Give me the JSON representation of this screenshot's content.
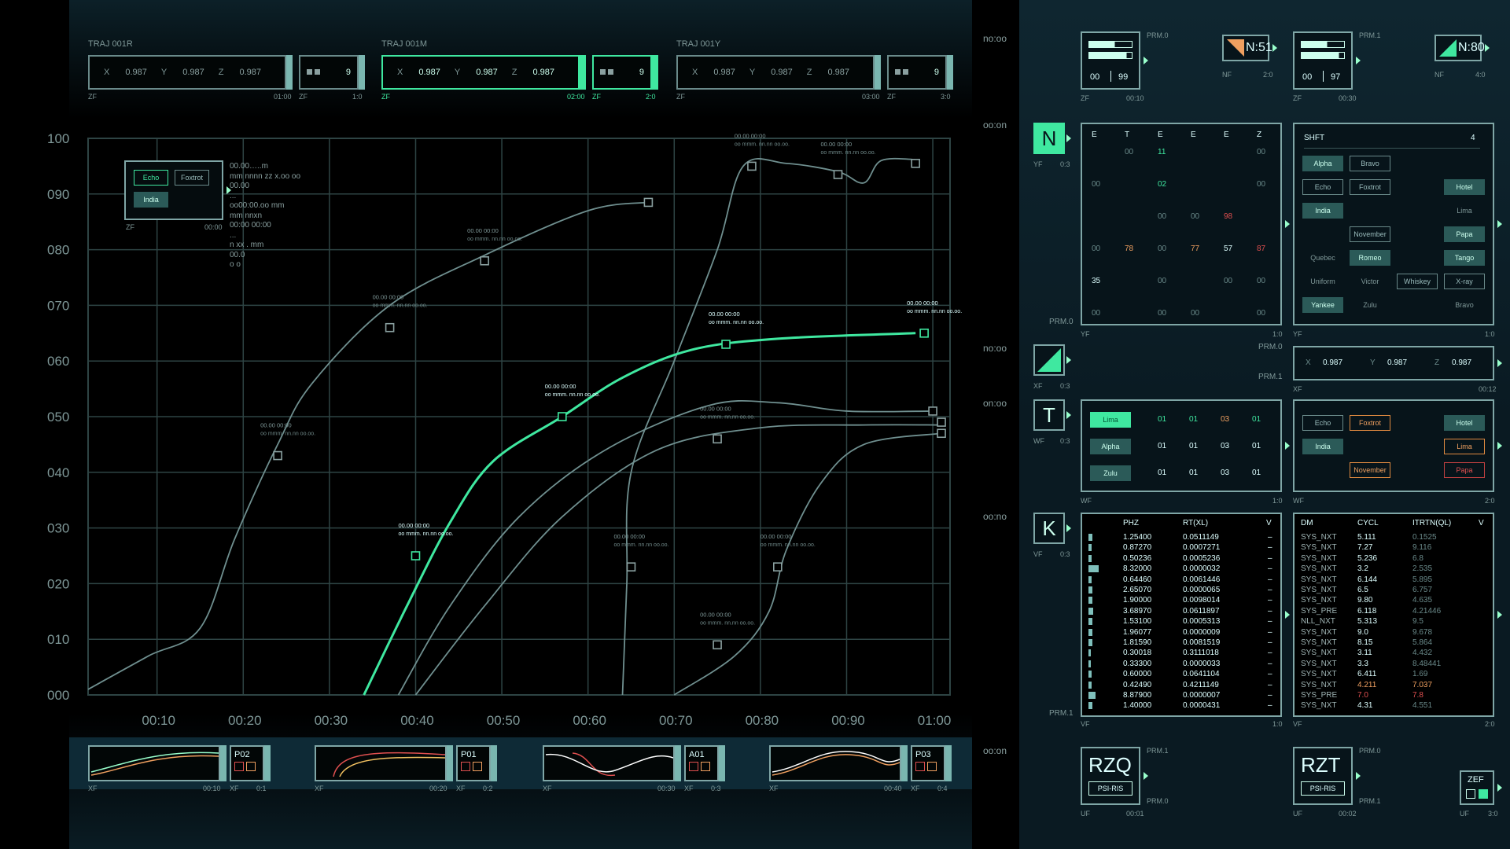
{
  "trajectories": [
    {
      "title": "TRAJ 001R",
      "x": "0.987",
      "y": "0.987",
      "z": "0.987",
      "count": "9",
      "left_foot": "ZF",
      "time": "01:00",
      "mini_foot": "ZF",
      "ratio": "1:0",
      "active": false
    },
    {
      "title": "TRAJ 001M",
      "x": "0.987",
      "y": "0.987",
      "z": "0.987",
      "count": "9",
      "left_foot": "ZF",
      "time": "02:00",
      "mini_foot": "ZF",
      "ratio": "2:0",
      "active": true
    },
    {
      "title": "TRAJ 001Y",
      "x": "0.987",
      "y": "0.987",
      "z": "0.987",
      "count": "9",
      "left_foot": "ZF",
      "time": "03:00",
      "mini_foot": "ZF",
      "ratio": "3:0",
      "active": false
    }
  ],
  "axis_letters": {
    "x": "X",
    "y": "Y",
    "z": "Z"
  },
  "legend": {
    "buttons": [
      "Echo",
      "Foxtrot",
      "India"
    ],
    "foot_left": "ZF",
    "foot_right": "00:00",
    "text_lines": [
      "00.00…..m",
      "mm nnnn zz x.oo oo",
      "00.00",
      "...",
      "oo00:00.oo mm",
      "mm nnxn",
      "00:00 00:00",
      "...",
      "n xx . mm",
      "00.0",
      "o o"
    ]
  },
  "chart_data": {
    "type": "line",
    "x_ticks": [
      "00:10",
      "00:20",
      "00:30",
      "00:40",
      "00:50",
      "00:60",
      "00:70",
      "00:80",
      "00:90",
      "01:00"
    ],
    "y_ticks": [
      "000",
      "010",
      "020",
      "030",
      "040",
      "050",
      "060",
      "070",
      "080",
      "090",
      "100"
    ],
    "ylim": [
      0,
      100
    ],
    "xlim": [
      0,
      100
    ],
    "grid": true,
    "series": [
      {
        "highlight": false,
        "points": [
          [
            0,
            1
          ],
          [
            7,
            7
          ],
          [
            13,
            12
          ],
          [
            17,
            28
          ],
          [
            22,
            45
          ],
          [
            26,
            56
          ],
          [
            35,
            70
          ],
          [
            46,
            79
          ],
          [
            58,
            87
          ],
          [
            65,
            88.5
          ]
        ]
      },
      {
        "highlight": false,
        "points": [
          [
            62,
            0
          ],
          [
            62.5,
            20
          ],
          [
            63,
            40
          ],
          [
            68,
            60
          ],
          [
            73,
            80
          ],
          [
            76,
            95
          ],
          [
            81,
            95.5
          ],
          [
            87,
            94
          ],
          [
            90,
            92
          ],
          [
            92,
            96
          ],
          [
            96,
            96.2
          ]
        ]
      },
      {
        "highlight": true,
        "points": [
          [
            32,
            0
          ],
          [
            37,
            16
          ],
          [
            42,
            31
          ],
          [
            47,
            42
          ],
          [
            55,
            50
          ],
          [
            62,
            57
          ],
          [
            70,
            62
          ],
          [
            80,
            64
          ],
          [
            96,
            65
          ]
        ]
      },
      {
        "highlight": false,
        "points": [
          [
            36,
            0
          ],
          [
            42,
            16
          ],
          [
            50,
            32
          ],
          [
            60,
            44
          ],
          [
            72,
            52
          ],
          [
            80,
            52.5
          ],
          [
            88,
            51
          ],
          [
            98,
            51
          ]
        ]
      },
      {
        "highlight": false,
        "points": [
          [
            38,
            0
          ],
          [
            46,
            16
          ],
          [
            55,
            32
          ],
          [
            66,
            44
          ],
          [
            78,
            48
          ],
          [
            90,
            48.5
          ],
          [
            99,
            48.5
          ]
        ]
      },
      {
        "highlight": false,
        "points": [
          [
            68,
            0
          ],
          [
            75,
            7
          ],
          [
            79,
            15
          ],
          [
            81,
            26
          ],
          [
            85,
            38
          ],
          [
            90,
            45
          ],
          [
            99,
            47
          ]
        ]
      }
    ],
    "markers": [
      {
        "x": 22,
        "y": 43,
        "label": "00.00 00:00",
        "highlight": false
      },
      {
        "x": 35,
        "y": 66,
        "label": "00.00 00:00",
        "highlight": false
      },
      {
        "x": 46,
        "y": 78,
        "label": "00.00 00:00",
        "highlight": false
      },
      {
        "x": 65,
        "y": 88.5,
        "label": "",
        "highlight": false
      },
      {
        "x": 38,
        "y": 25,
        "label": "00.00 00:00",
        "highlight": true
      },
      {
        "x": 55,
        "y": 50,
        "label": "00.00 00:00",
        "highlight": true
      },
      {
        "x": 74,
        "y": 63,
        "label": "00.00 00:00",
        "highlight": true
      },
      {
        "x": 97,
        "y": 65,
        "label": "00.00 00:00",
        "highlight": true
      },
      {
        "x": 63,
        "y": 23,
        "label": "00.00 00:00",
        "highlight": false
      },
      {
        "x": 73,
        "y": 46,
        "label": "00.00 00:00",
        "highlight": false
      },
      {
        "x": 77,
        "y": 95,
        "label": "00.00 00:00",
        "highlight": false
      },
      {
        "x": 87,
        "y": 93.5,
        "label": "00.00 00:00",
        "highlight": false
      },
      {
        "x": 96,
        "y": 95.5,
        "label": "",
        "highlight": false
      },
      {
        "x": 98,
        "y": 51,
        "label": "",
        "highlight": false
      },
      {
        "x": 99,
        "y": 49,
        "label": "",
        "highlight": false
      },
      {
        "x": 99,
        "y": 47,
        "label": "",
        "highlight": false
      },
      {
        "x": 80,
        "y": 23,
        "label": "00.00 00:00",
        "highlight": false
      },
      {
        "x": 73,
        "y": 9,
        "label": "00.00 00:00",
        "highlight": false
      }
    ],
    "marker_sublabel": "oo mmm. nn.nn oo.oo."
  },
  "strips": [
    {
      "code": "P02",
      "foot": "XF",
      "time": "00:10",
      "ratio": "0:1"
    },
    {
      "code": "P01",
      "foot": "XF",
      "time": "00:20",
      "ratio": "0:2"
    },
    {
      "code": "A01",
      "foot": "XF",
      "time": "00:30",
      "ratio": "0:3"
    },
    {
      "code": "P03",
      "foot": "XF",
      "time": "00:40",
      "ratio": "0:4"
    }
  ],
  "divider_labels": [
    "no:oo",
    "oo:on",
    "no:oo",
    "on:oo",
    "oo:no",
    "oo:on"
  ],
  "right": {
    "top_left": {
      "prm": "PRM.0",
      "left": "00",
      "right": "99",
      "foot": "ZF",
      "time": "00:10"
    },
    "n51": {
      "label": "N:51",
      "foot": "NF",
      "ratio": "2:0"
    },
    "top_right": {
      "prm": "PRM.1",
      "left": "00",
      "right": "97",
      "foot": "ZF",
      "time": "00:30"
    },
    "n80": {
      "label": "N:80",
      "foot": "NF",
      "ratio": "4:0"
    },
    "n_icon": {
      "letter": "N",
      "foot": "YF",
      "ratio": "0:3"
    },
    "grid_headers": [
      "E",
      "T",
      "E",
      "E",
      "E",
      "Z"
    ],
    "grid_foot": "YF",
    "grid_ratio": "1:0",
    "grid_prm": "PRM.0",
    "grid_cells": [
      {
        "c": 1,
        "r": 0,
        "v": "00",
        "k": ""
      },
      {
        "c": 2,
        "r": 0,
        "v": "11",
        "k": "g"
      },
      {
        "c": 5,
        "r": 0,
        "v": "00",
        "k": ""
      },
      {
        "c": 0,
        "r": 1,
        "v": "00",
        "k": ""
      },
      {
        "c": 2,
        "r": 1,
        "v": "02",
        "k": "g"
      },
      {
        "c": 5,
        "r": 1,
        "v": "00",
        "k": ""
      },
      {
        "c": 2,
        "r": 2,
        "v": "00",
        "k": ""
      },
      {
        "c": 3,
        "r": 2,
        "v": "00",
        "k": ""
      },
      {
        "c": 4,
        "r": 2,
        "v": "98",
        "k": "r"
      },
      {
        "c": 0,
        "r": 3,
        "v": "00",
        "k": ""
      },
      {
        "c": 1,
        "r": 3,
        "v": "78",
        "k": "o"
      },
      {
        "c": 2,
        "r": 3,
        "v": "00",
        "k": ""
      },
      {
        "c": 3,
        "r": 3,
        "v": "77",
        "k": "o"
      },
      {
        "c": 4,
        "r": 3,
        "v": "57",
        "k": "w"
      },
      {
        "c": 5,
        "r": 3,
        "v": "87",
        "k": "r"
      },
      {
        "c": 0,
        "r": 4,
        "v": "35",
        "k": "w"
      },
      {
        "c": 2,
        "r": 4,
        "v": "00",
        "k": ""
      },
      {
        "c": 4,
        "r": 4,
        "v": "00",
        "k": ""
      },
      {
        "c": 5,
        "r": 4,
        "v": "00",
        "k": ""
      },
      {
        "c": 0,
        "r": 5,
        "v": "00",
        "k": ""
      },
      {
        "c": 2,
        "r": 5,
        "v": "00",
        "k": ""
      },
      {
        "c": 3,
        "r": 5,
        "v": "00",
        "k": ""
      },
      {
        "c": 5,
        "r": 5,
        "v": "00",
        "k": ""
      }
    ],
    "shft": {
      "title": "SHFT",
      "count": "4",
      "foot": "YF",
      "ratio": "1:0",
      "buttons": [
        {
          "t": "Alpha",
          "s": "f",
          "c": 0,
          "r": 0
        },
        {
          "t": "Bravo",
          "s": "o",
          "c": 1,
          "r": 0
        },
        {
          "t": "Echo",
          "s": "o",
          "c": 0,
          "r": 1
        },
        {
          "t": "Foxtrot",
          "s": "o",
          "c": 1,
          "r": 1
        },
        {
          "t": "Hotel",
          "s": "f",
          "c": 3,
          "r": 1
        },
        {
          "t": "India",
          "s": "f",
          "c": 0,
          "r": 2
        },
        {
          "t": "Lima",
          "s": "t",
          "c": 3,
          "r": 2
        },
        {
          "t": "November",
          "s": "o",
          "c": 1,
          "r": 3
        },
        {
          "t": "Papa",
          "s": "f",
          "c": 3,
          "r": 3
        },
        {
          "t": "Quebec",
          "s": "t",
          "c": 0,
          "r": 4
        },
        {
          "t": "Romeo",
          "s": "f",
          "c": 1,
          "r": 4
        },
        {
          "t": "Tango",
          "s": "f",
          "c": 3,
          "r": 4
        },
        {
          "t": "Uniform",
          "s": "t",
          "c": 0,
          "r": 5
        },
        {
          "t": "Victor",
          "s": "t",
          "c": 1,
          "r": 5
        },
        {
          "t": "Whiskey",
          "s": "o",
          "c": 2,
          "r": 5
        },
        {
          "t": "X-ray",
          "s": "o",
          "c": 3,
          "r": 5
        },
        {
          "t": "Yankee",
          "s": "f",
          "c": 0,
          "r": 6
        },
        {
          "t": "Zulu",
          "s": "t",
          "c": 1,
          "r": 6
        },
        {
          "t": "Bravo",
          "s": "t",
          "c": 3,
          "r": 6
        }
      ]
    },
    "prm_mid_0": "PRM.0",
    "prm_mid_1": "PRM.1",
    "tri_icon": {
      "foot": "XF",
      "ratio": "0:3"
    },
    "xyz": {
      "x": "0.987",
      "y": "0.987",
      "z": "0.987",
      "foot": "XF",
      "time": "00:12"
    },
    "t_icon": {
      "letter": "T",
      "foot": "WF",
      "ratio": "0:3"
    },
    "t_rows": [
      {
        "name": "Lima",
        "active": true,
        "vals": [
          [
            "01",
            "g"
          ],
          [
            "01",
            "g"
          ],
          [
            "03",
            "o"
          ],
          [
            "01",
            "g"
          ]
        ]
      },
      {
        "name": "Alpha",
        "active": false,
        "vals": [
          [
            "01",
            "w"
          ],
          [
            "01",
            "w"
          ],
          [
            "03",
            "w"
          ],
          [
            "01",
            "w"
          ]
        ]
      },
      {
        "name": "Zulu",
        "active": false,
        "vals": [
          [
            "01",
            "w"
          ],
          [
            "01",
            "w"
          ],
          [
            "03",
            "w"
          ],
          [
            "01",
            "w"
          ]
        ]
      }
    ],
    "t_foot": "WF",
    "t_ratio": "1:0",
    "tr_buttons": [
      {
        "t": "Echo",
        "s": "o",
        "c": 0,
        "r": 0
      },
      {
        "t": "Foxtrot",
        "s": "orange",
        "c": 1,
        "r": 0
      },
      {
        "t": "Hotel",
        "s": "f",
        "c": 3,
        "r": 0
      },
      {
        "t": "India",
        "s": "f",
        "c": 0,
        "r": 1
      },
      {
        "t": "Lima",
        "s": "orange",
        "c": 3,
        "r": 1
      },
      {
        "t": "November",
        "s": "orange",
        "c": 1,
        "r": 2
      },
      {
        "t": "Papa",
        "s": "red",
        "c": 3,
        "r": 2
      }
    ],
    "tr_foot": "WF",
    "tr_ratio": "2:0",
    "k_icon": {
      "letter": "K",
      "foot": "VF",
      "ratio": "0:3"
    },
    "phz_headers": [
      "PHZ",
      "RT(XL)",
      "V"
    ],
    "phz_rows": [
      {
        "a": "1.25400",
        "b": "0.0511149",
        "v": "–",
        "bar": 0.3
      },
      {
        "a": "0.87270",
        "b": "0.0007271",
        "v": "–",
        "bar": 0.2
      },
      {
        "a": "0.50236",
        "b": "0.0005236",
        "v": "–",
        "bar": 0.2
      },
      {
        "a": "8.32000",
        "b": "0.0000032",
        "v": "–",
        "bar": 0.7
      },
      {
        "a": "0.64460",
        "b": "0.0061446",
        "v": "–",
        "bar": 0.2
      },
      {
        "a": "2.65070",
        "b": "0.0000065",
        "v": "–",
        "bar": 0.3
      },
      {
        "a": "1.90000",
        "b": "0.0098014",
        "v": "–",
        "bar": 0.25
      },
      {
        "a": "3.68970",
        "b": "0.0611897",
        "v": "–",
        "bar": 0.35
      },
      {
        "a": "1.53100",
        "b": "0.0005313",
        "v": "–",
        "bar": 0.25
      },
      {
        "a": "1.96077",
        "b": "0.0000009",
        "v": "–",
        "bar": 0.25
      },
      {
        "a": "1.81590",
        "b": "0.0081519",
        "v": "–",
        "bar": 0.25
      },
      {
        "a": "0.30018",
        "b": "0.3111018",
        "v": "–",
        "bar": 0.15
      },
      {
        "a": "0.33300",
        "b": "0.0000033",
        "v": "–",
        "bar": 0.15
      },
      {
        "a": "0.60000",
        "b": "0.0641104",
        "v": "–",
        "bar": 0.2
      },
      {
        "a": "0.42490",
        "b": "0.4211149",
        "v": "–",
        "bar": 0.2
      },
      {
        "a": "8.87900",
        "b": "0.0000007",
        "v": "–",
        "bar": 0.5
      },
      {
        "a": "1.40000",
        "b": "0.0000431",
        "v": "–",
        "bar": 0.25
      }
    ],
    "phz_foot": "VF",
    "phz_ratio": "1:0",
    "phz_prm": "PRM.1",
    "dm_headers": [
      "DM",
      "CYCL",
      "ITRTN(QL)",
      "V"
    ],
    "dm_rows": [
      {
        "a": "SYS_NXT",
        "b": "5.111",
        "c": "0.1525",
        "k": ""
      },
      {
        "a": "SYS_NXT",
        "b": "7.27",
        "c": "9.116",
        "k": ""
      },
      {
        "a": "SYS_NXT",
        "b": "5.236",
        "c": "6.8",
        "k": ""
      },
      {
        "a": "SYS_NXT",
        "b": "3.2",
        "c": "2.535",
        "k": ""
      },
      {
        "a": "SYS_NXT",
        "b": "6.144",
        "c": "5.895",
        "k": ""
      },
      {
        "a": "SYS_NXT",
        "b": "6.5",
        "c": "6.757",
        "k": ""
      },
      {
        "a": "SYS_NXT",
        "b": "9.80",
        "c": "4.635",
        "k": ""
      },
      {
        "a": "SYS_PRE",
        "b": "6.118",
        "c": "4.21446",
        "k": ""
      },
      {
        "a": "NLL_NXT",
        "b": "5.313",
        "c": "9.5",
        "k": ""
      },
      {
        "a": "SYS_NXT",
        "b": "9.0",
        "c": "9.678",
        "k": ""
      },
      {
        "a": "SYS_NXT",
        "b": "8.15",
        "c": "5.864",
        "k": ""
      },
      {
        "a": "SYS_NXT",
        "b": "3.11",
        "c": "4.432",
        "k": ""
      },
      {
        "a": "SYS_NXT",
        "b": "3.3",
        "c": "8.48441",
        "k": ""
      },
      {
        "a": "SYS_NXT",
        "b": "6.411",
        "c": "1.69",
        "k": ""
      },
      {
        "a": "SYS_NXT",
        "b": "4.211",
        "c": "7.037",
        "k": "o"
      },
      {
        "a": "SYS_PRE",
        "b": "7.0",
        "c": "7.8",
        "k": "r"
      },
      {
        "a": "SYS_NXT",
        "b": "4.31",
        "c": "4.551",
        "k": ""
      }
    ],
    "dm_foot": "VF",
    "dm_ratio": "2:0",
    "rzq": {
      "code": "RZQ",
      "sub": "PSI-RIS",
      "prm_top": "PRM.1",
      "prm_bot": "PRM.0",
      "foot": "UF",
      "time": "00:01"
    },
    "rzt": {
      "code": "RZT",
      "sub": "PSI-RIS",
      "prm_top": "PRM.0",
      "prm_bot": "PRM.1",
      "foot": "UF",
      "time": "00:02"
    },
    "zef": {
      "code": "ZEF",
      "foot": "UF",
      "ratio": "3:0"
    }
  },
  "colors": {
    "accent": "#3fe8a0",
    "grid": "#2e4444",
    "line": "#6f8f8f",
    "orange": "#f0a060",
    "red": "#e05050"
  }
}
